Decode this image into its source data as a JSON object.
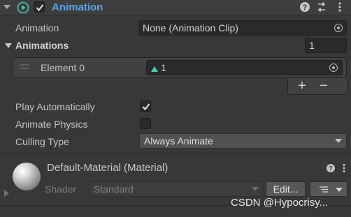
{
  "component": {
    "title": "Animation",
    "enabled": true,
    "header_icons": [
      "help-icon",
      "preset-icon",
      "kebab-menu-icon"
    ]
  },
  "fields": {
    "animation_label": "Animation",
    "animation_value": "None (Animation Clip)",
    "animations_label": "Animations",
    "animations_count": "1",
    "element_label": "Element 0",
    "element_value": "1",
    "plus_label": "+",
    "minus_label": "−",
    "play_auto_label": "Play Automatically",
    "play_auto_checked": true,
    "animate_physics_label": "Animate Physics",
    "animate_physics_checked": false,
    "culling_label": "Culling Type",
    "culling_value": "Always Animate"
  },
  "material": {
    "name": "Default-Material (Material)",
    "shader_label": "Shader",
    "shader_value": "Standard",
    "edit_label": "Edit..."
  },
  "watermark": "CSDN @Hypocrisy...",
  "colors": {
    "title_blue": "#5aa5f0",
    "background": "#383838",
    "field_bg": "#2a2a2a"
  }
}
